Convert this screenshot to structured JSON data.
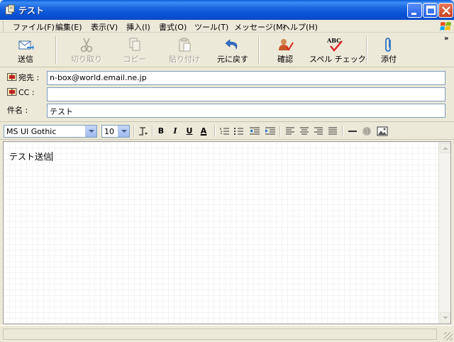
{
  "window": {
    "title": "テスト"
  },
  "menu": [
    "ファイル(F)",
    "編集(E)",
    "表示(V)",
    "挿入(I)",
    "書式(O)",
    "ツール(T)",
    "メッセージ(M)",
    "ヘルプ(H)"
  ],
  "toolbar": {
    "send": "送信",
    "cut": "切り取り",
    "copy": "コピー",
    "paste": "貼り付け",
    "undo": "元に戻す",
    "check": "確認",
    "spell": "スペル チェック",
    "spell_icon_text": "ABC",
    "attach": "添付",
    "overflow": "»"
  },
  "header": {
    "to_label": "宛先 :",
    "to_value": "n-box@world.email.ne.jp",
    "cc_label": "CC :",
    "cc_value": "",
    "subject_label": "件名 :",
    "subject_value": "テスト"
  },
  "format": {
    "font": "MS UI Gothic",
    "size": "10",
    "bold": "B",
    "italic": "I",
    "underline": "U",
    "color": "A"
  },
  "body": {
    "text": "テスト送信"
  },
  "colors": {
    "title_bar": "#0a5bd8",
    "close_button": "#c93e1e",
    "face": "#ece9d8"
  }
}
